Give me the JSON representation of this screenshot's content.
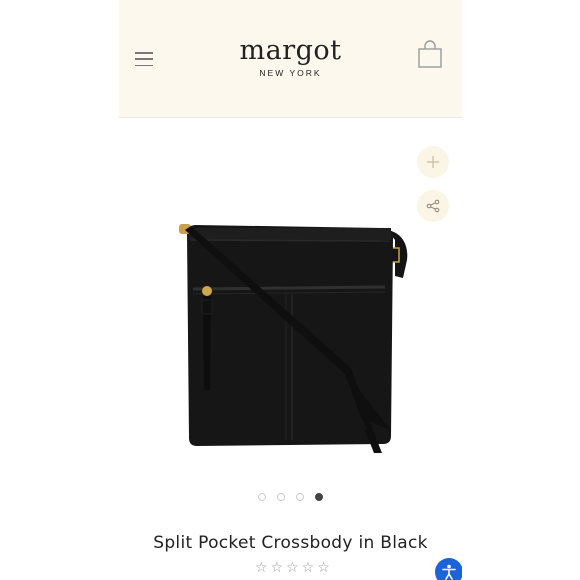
{
  "brand": {
    "name": "margot",
    "tagline": "NEW YORK"
  },
  "icons": {
    "menu": "hamburger-icon",
    "cart": "shopping-bag-icon",
    "zoom": "plus-icon",
    "share": "share-icon",
    "accessibility": "accessibility-icon"
  },
  "gallery": {
    "total_images": 4,
    "active_index": 3
  },
  "product": {
    "title": "Split Pocket Crossbody in Black",
    "rating_stars": "☆☆☆☆☆"
  },
  "colors": {
    "header_bg": "#fcf8ed",
    "accessibility_blue": "#1a63d8",
    "bag_black": "#141414"
  }
}
